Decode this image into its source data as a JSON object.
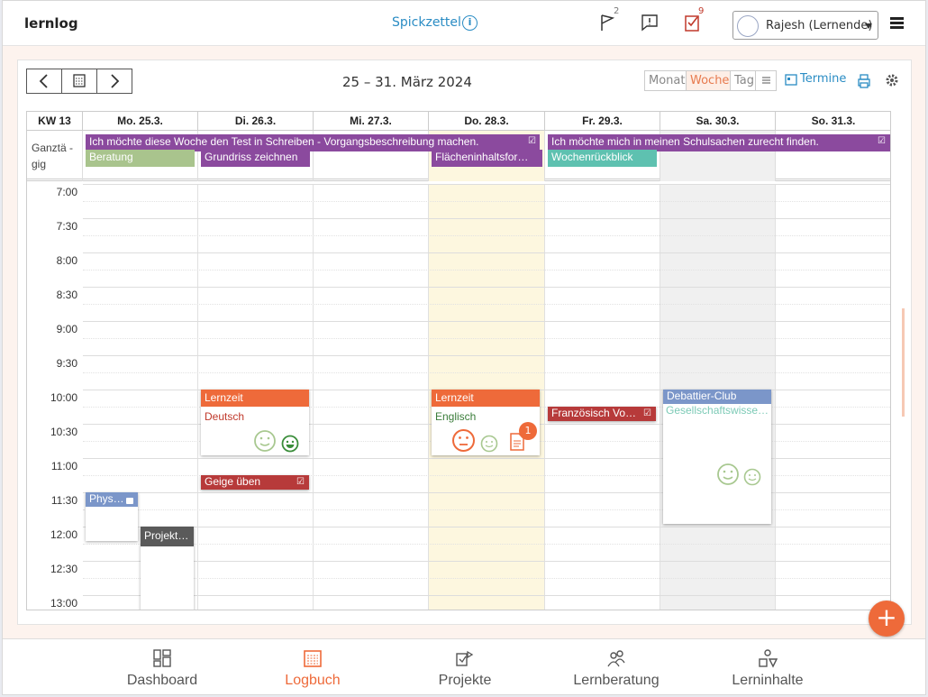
{
  "app": {
    "title": "lernlog",
    "spickzettel": "Spickzettel",
    "user": "Rajesh (Lernende)",
    "badges": {
      "flag": "2",
      "check": "9"
    },
    "icons": [
      "info-icon",
      "flag-icon",
      "message-icon",
      "checklist-icon",
      "menu-icon"
    ]
  },
  "calendar": {
    "range": "25 – 31. März 2024",
    "views": [
      "Monat",
      "Woche",
      "Tag"
    ],
    "active_view": "Woche",
    "termine": "Termine",
    "week_label": "KW 13",
    "days": [
      "Mo. 25.3.",
      "Di. 26.3.",
      "Mi. 27.3.",
      "Do. 28.3.",
      "Fr. 29.3.",
      "Sa. 30.3.",
      "So. 31.3."
    ],
    "allday_label": "Ganztä\n-gig",
    "times": [
      "7:00",
      "7:30",
      "8:00",
      "8:30",
      "9:00",
      "9:30",
      "10:00",
      "10:30",
      "11:00",
      "11:30",
      "12:00",
      "12:30",
      "13:00"
    ],
    "allday_events": [
      {
        "title": "Ich möchte diese Woche den Test in Schreiben - Vorgangsbeschreibung machen.",
        "color": "#8b4a9e"
      },
      {
        "title": "Ich möchte mich in meinen Schulsachen zurecht finden.",
        "color": "#8b4a9e"
      },
      {
        "title": "Beratung",
        "color": "#a9c48d"
      },
      {
        "title": "Grundriss zeichnen",
        "color": "#8b4a9e"
      },
      {
        "title": "Flächeninhaltsfor…",
        "color": "#8b4a9e"
      },
      {
        "title": "Wochenrückblick",
        "color": "#5ec1b0"
      }
    ],
    "events": [
      {
        "title": "Lernzeit",
        "subject": "Deutsch",
        "color": "#ee6a3a",
        "subject_color": "#c0392b"
      },
      {
        "title": "Lernzeit",
        "subject": "Englisch",
        "color": "#ee6a3a",
        "subject_color": "#3a7d3a",
        "badge": "1"
      },
      {
        "title": "Geige üben",
        "color": "#b73a3a"
      },
      {
        "title": "Französisch Vo…",
        "color": "#b73a3a"
      },
      {
        "title": "Debattier-Club",
        "subject": "Gesellschaftswisse…",
        "color": "#7b96c9",
        "subject_color": "#7ccab6"
      },
      {
        "title": "Phys…",
        "color": "#7b96c9"
      },
      {
        "title": "Projekt…",
        "color": "#5a5a5a"
      }
    ]
  },
  "nav": [
    "Dashboard",
    "Logbuch",
    "Projekte",
    "Lernberatung",
    "Lerninhalte"
  ],
  "active_nav": "Logbuch",
  "fab": "+"
}
